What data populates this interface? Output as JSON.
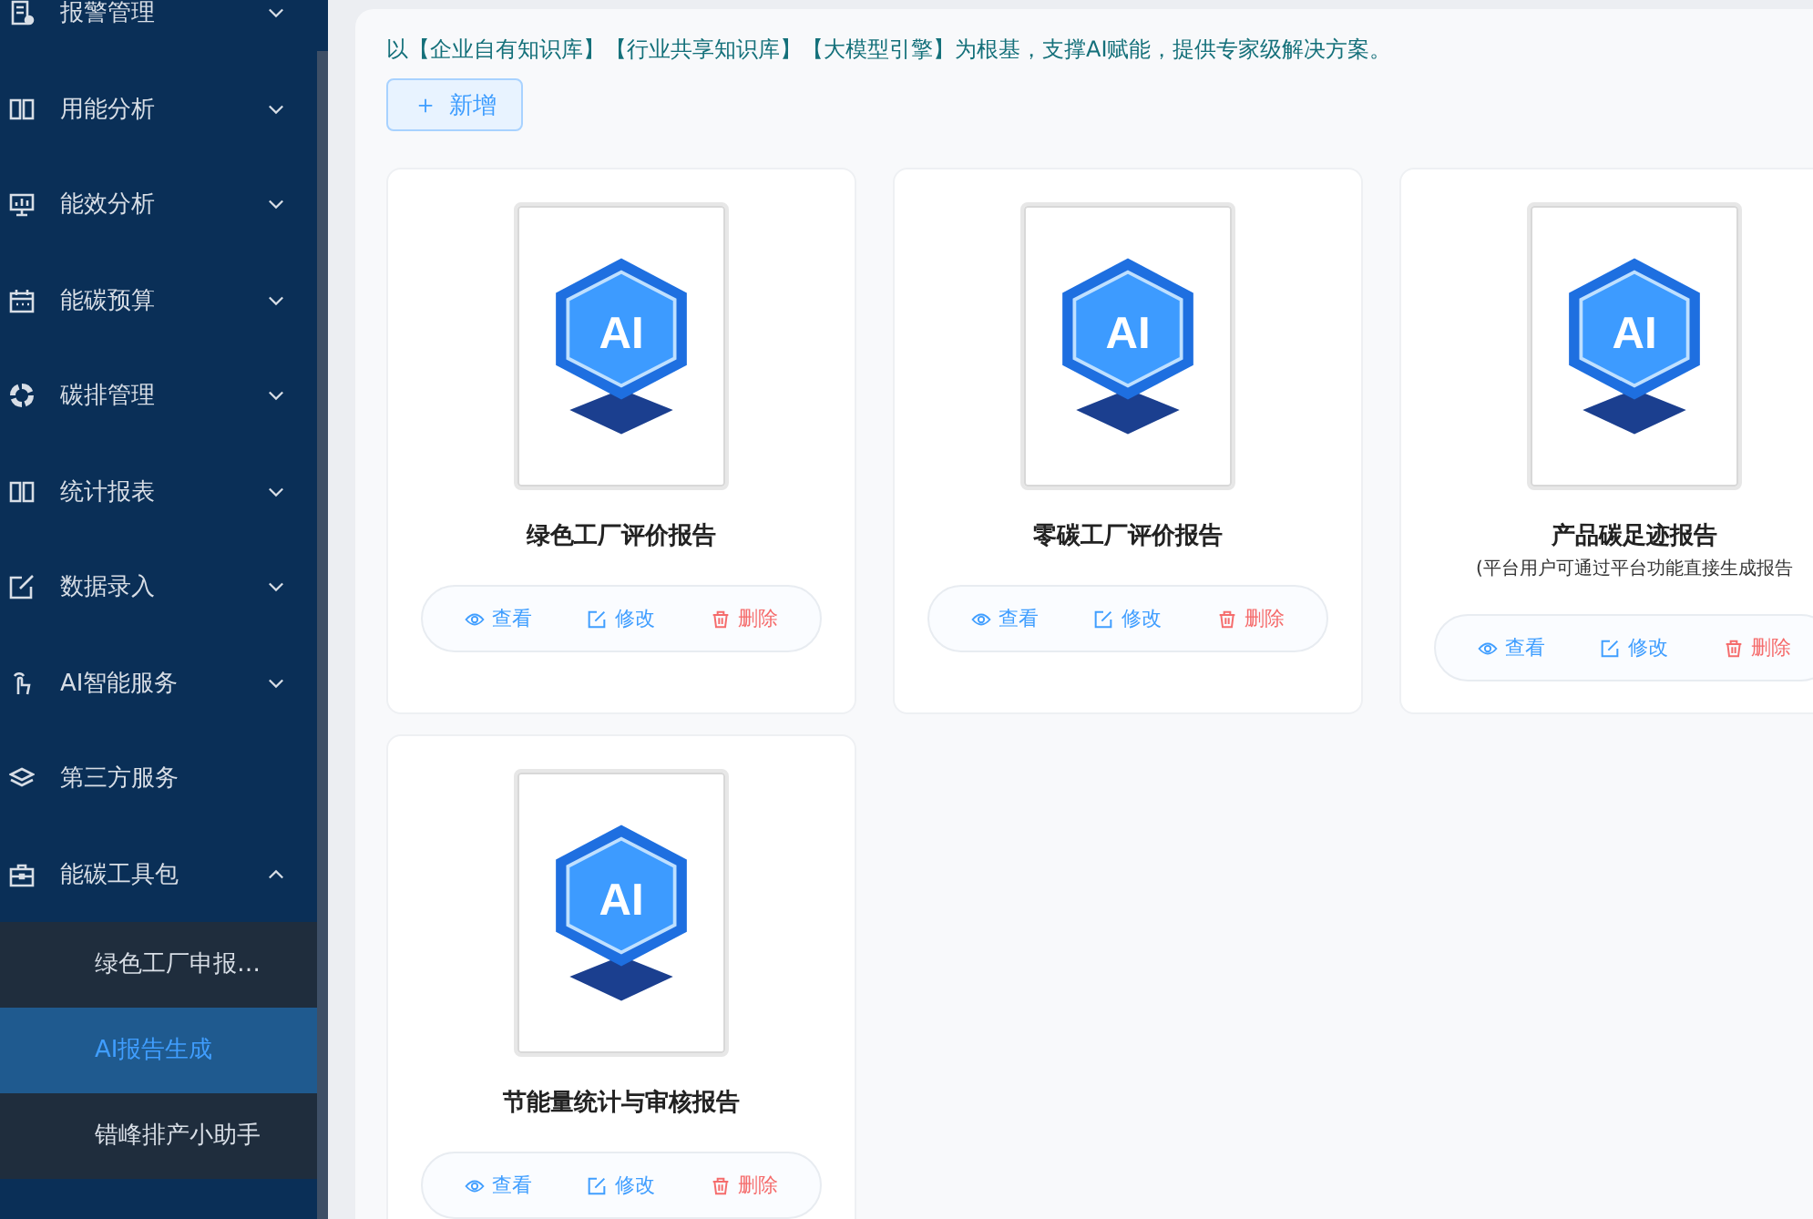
{
  "sidebar": {
    "items": [
      {
        "label": "报警管理",
        "kind": "group",
        "expanded": false
      },
      {
        "label": "用能分析",
        "kind": "group",
        "expanded": false
      },
      {
        "label": "能效分析",
        "kind": "group",
        "expanded": false
      },
      {
        "label": "能碳预算",
        "kind": "group",
        "expanded": false
      },
      {
        "label": "碳排管理",
        "kind": "group",
        "expanded": false
      },
      {
        "label": "统计报表",
        "kind": "group",
        "expanded": false
      },
      {
        "label": "数据录入",
        "kind": "group",
        "expanded": false
      },
      {
        "label": "AI智能服务",
        "kind": "group",
        "expanded": false
      },
      {
        "label": "第三方服务",
        "kind": "leaf"
      },
      {
        "label": "能碳工具包",
        "kind": "group",
        "expanded": true,
        "children": [
          {
            "label": "绿色工厂申报…",
            "selected": false
          },
          {
            "label": "AI报告生成",
            "selected": true
          },
          {
            "label": "错峰排产小助手",
            "selected": false
          }
        ]
      }
    ]
  },
  "intro": "以【企业自有知识库】【行业共享知识库】【大模型引擎】为根基，支撑AI赋能，提供专家级解决方案。",
  "add_button": {
    "icon": "＋",
    "label": "新增"
  },
  "cards": [
    {
      "badge": "AI",
      "title": "绿色工厂评价报告",
      "actions": [
        "查看",
        "修改",
        "删除"
      ]
    },
    {
      "badge": "AI",
      "title": "零碳工厂评价报告",
      "actions": [
        "查看",
        "修改",
        "删除"
      ]
    },
    {
      "badge": "AI",
      "title": "产品碳足迹报告",
      "note": "(平台用户可通过平台功能直接生成报告",
      "actions": [
        "查看",
        "修改",
        "删除"
      ]
    },
    {
      "badge": "AI",
      "title": "节能量统计与审核报告",
      "actions": [
        "查看",
        "修改",
        "删除"
      ]
    }
  ]
}
